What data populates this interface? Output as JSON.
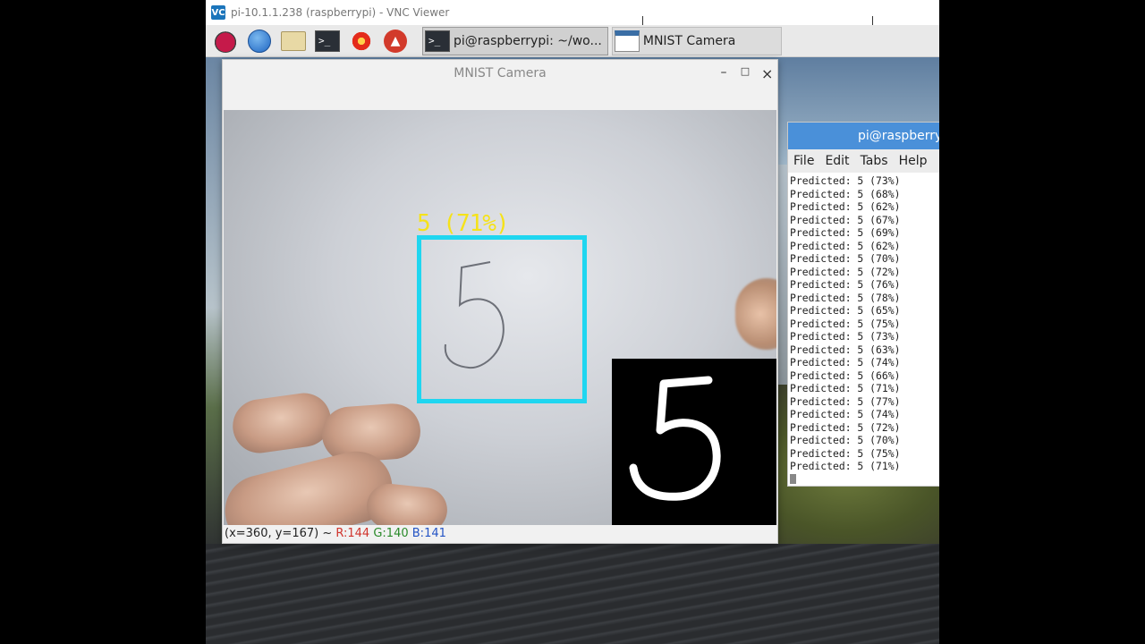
{
  "vnc": {
    "title": "pi-10.1.1.238 (raspberrypi) - VNC Viewer",
    "logo_text": "VC"
  },
  "taskbar": {
    "icons": [
      "raspberry-pi-menu-icon",
      "web-browser-icon",
      "file-manager-icon",
      "terminal-icon",
      "mathematica-icon",
      "wolfram-icon"
    ],
    "tasks": [
      {
        "label": "pi@raspberrypi: ~/wo..."
      },
      {
        "label": "MNIST Camera"
      }
    ],
    "terminal_glyph": ">_"
  },
  "camera_window": {
    "title": "MNIST Camera",
    "controls": {
      "minimize": "–",
      "maximize": "□",
      "close": "×"
    },
    "detection_label": "5 (71%)",
    "detected_digit": "5",
    "status": {
      "coords": "(x=360, y=167) ~ ",
      "r": "R:144",
      "g": "G:140",
      "b": "B:141"
    },
    "colors": {
      "bbox": "#1fd6f0",
      "label": "#f5e21a"
    }
  },
  "terminal_window": {
    "title": "pi@raspberrypi: ~/wo",
    "menu": [
      "File",
      "Edit",
      "Tabs",
      "Help"
    ],
    "lines": [
      "Predicted: 5 (73%)",
      "Predicted: 5 (68%)",
      "Predicted: 5 (62%)",
      "Predicted: 5 (67%)",
      "Predicted: 5 (69%)",
      "Predicted: 5 (62%)",
      "Predicted: 5 (70%)",
      "Predicted: 5 (72%)",
      "Predicted: 5 (76%)",
      "Predicted: 5 (78%)",
      "Predicted: 5 (65%)",
      "Predicted: 5 (75%)",
      "Predicted: 5 (73%)",
      "Predicted: 5 (63%)",
      "Predicted: 5 (74%)",
      "Predicted: 5 (66%)",
      "Predicted: 5 (71%)",
      "Predicted: 5 (77%)",
      "Predicted: 5 (74%)",
      "Predicted: 5 (72%)",
      "Predicted: 5 (70%)",
      "Predicted: 5 (75%)",
      "Predicted: 5 (71%)"
    ]
  }
}
